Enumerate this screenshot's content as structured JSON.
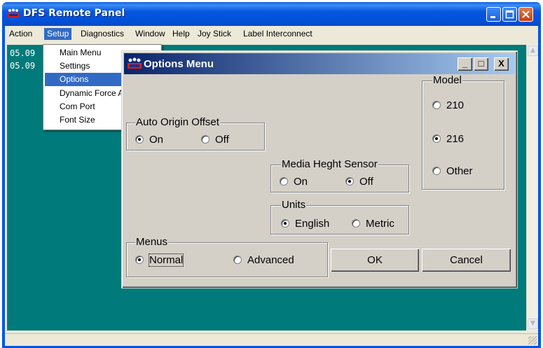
{
  "app": {
    "title": "DFS Remote Panel",
    "icon": "dfs-app-icon"
  },
  "menubar": {
    "items": [
      {
        "label": "Action"
      },
      {
        "label": "Setup",
        "active": true
      },
      {
        "label": "Diagnostics"
      },
      {
        "label": "Window"
      },
      {
        "label": "Help"
      },
      {
        "label": "Joy Stick"
      },
      {
        "label": "Label Interconnect"
      }
    ]
  },
  "setup_menu": {
    "items": [
      {
        "label": "Main Menu"
      },
      {
        "label": "Settings"
      },
      {
        "label": "Options",
        "highlighted": true
      },
      {
        "label": "Dynamic Force A"
      },
      {
        "label": "Com Port"
      },
      {
        "label": "Font Size"
      }
    ]
  },
  "log": {
    "lines": [
      "05.09",
      "05.09"
    ]
  },
  "dialog": {
    "title": "Options Menu",
    "buttons": {
      "minimize": "_",
      "maximize": "□",
      "close": "X"
    },
    "auto_origin_offset": {
      "title": "Auto Origin Offset",
      "on": "On",
      "off": "Off",
      "selected": "On"
    },
    "media_height_sensor": {
      "title": "Media Heght Sensor",
      "on": "On",
      "off": "Off",
      "selected": "Off"
    },
    "units": {
      "title": "Units",
      "english": "English",
      "metric": "Metric",
      "selected": "English"
    },
    "model": {
      "title": "Model",
      "opt_210": "210",
      "opt_216": "216",
      "opt_other": "Other",
      "selected": "216"
    },
    "menus": {
      "title": "Menus",
      "normal": "Normal",
      "advanced": "Advanced",
      "selected": "Normal"
    },
    "ok_label": "OK",
    "cancel_label": "Cancel"
  },
  "colors": {
    "desktop_teal": "#007a7a",
    "xp_title_blue": "#0055e5",
    "dialog_title_start": "#0a246a",
    "dialog_title_end": "#a6caf0",
    "menu_highlight": "#316ac5",
    "dialog_face": "#d4d0c8"
  }
}
